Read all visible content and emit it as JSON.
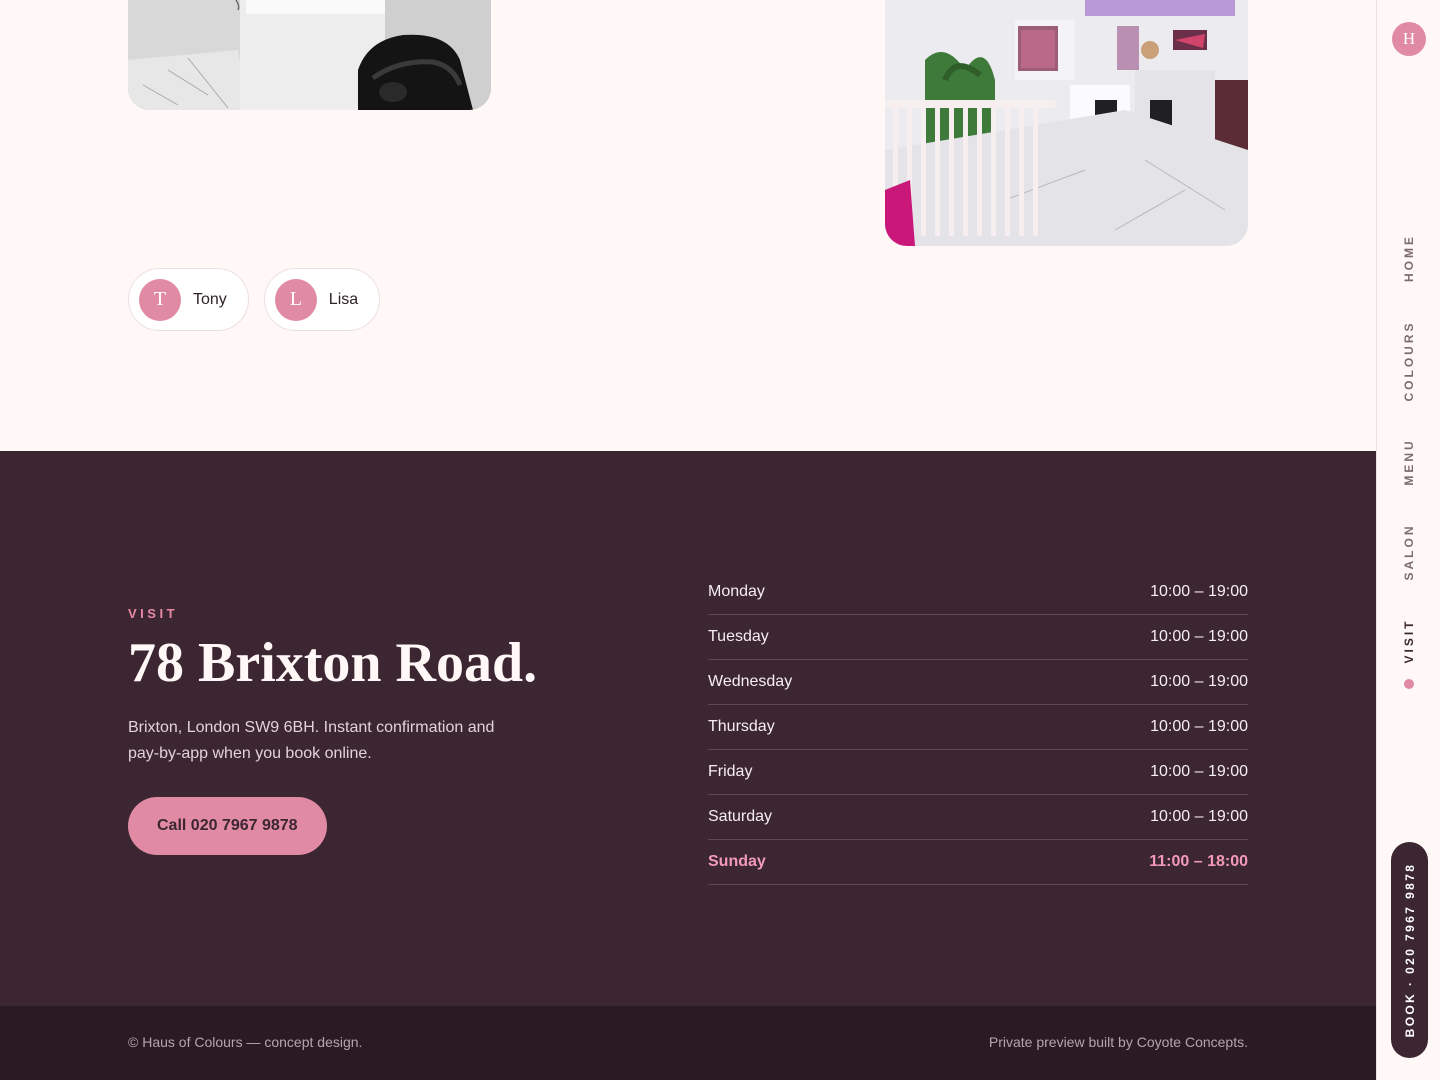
{
  "team": [
    {
      "initial": "T",
      "name": "Tony"
    },
    {
      "initial": "L",
      "name": "Lisa"
    }
  ],
  "visit": {
    "eyebrow": "VISIT",
    "heading": "78 Brixton Road.",
    "description": "Brixton, London SW9 6BH. Instant confirmation and pay-by-app when you book online.",
    "call_label": "Call 020 7967 9878"
  },
  "hours": [
    {
      "day": "Monday",
      "time": "10:00 – 19:00"
    },
    {
      "day": "Tuesday",
      "time": "10:00 – 19:00"
    },
    {
      "day": "Wednesday",
      "time": "10:00 – 19:00"
    },
    {
      "day": "Thursday",
      "time": "10:00 – 19:00"
    },
    {
      "day": "Friday",
      "time": "10:00 – 19:00"
    },
    {
      "day": "Saturday",
      "time": "10:00 – 19:00"
    },
    {
      "day": "Sunday",
      "time": "11:00 – 18:00",
      "highlight": true
    }
  ],
  "footer": {
    "copyright": "© Haus of Colours — concept design.",
    "credit": "Private preview built by Coyote Concepts."
  },
  "rail": {
    "logo_initial": "H",
    "nav": [
      "HOME",
      "COLOURS",
      "MENU",
      "SALON",
      "VISIT"
    ],
    "active": "VISIT",
    "book_label": "BOOK · 020 7967 9878"
  },
  "colors": {
    "accent": "#e08aa3",
    "plum": "#3b2631",
    "cream": "#fff8f6",
    "footer": "#2a1b23"
  },
  "icons": {
    "logo": "h-monogram-icon",
    "active_indicator": "dot-icon"
  }
}
